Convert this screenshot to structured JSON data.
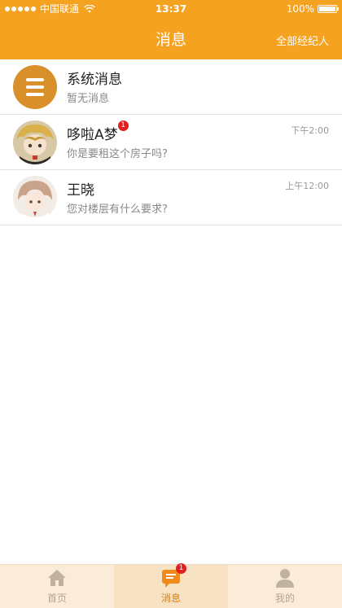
{
  "status_bar": {
    "carrier": "中国联通",
    "time": "13:37",
    "battery": "100%"
  },
  "header": {
    "title": "消息",
    "action": "全部经纪人"
  },
  "messages": [
    {
      "name": "系统消息",
      "preview": "暂无消息",
      "time": "",
      "badge": ""
    },
    {
      "name": "哆啦A梦",
      "preview": "你是要租这个房子吗?",
      "time": "下午2:00",
      "badge": "1"
    },
    {
      "name": "王晓",
      "preview": "您对楼层有什么要求?",
      "time": "上午12:00",
      "badge": ""
    }
  ],
  "tabs": [
    {
      "label": "首页",
      "icon": "home-icon"
    },
    {
      "label": "消息",
      "icon": "message-icon",
      "badge": "1"
    },
    {
      "label": "我的",
      "icon": "profile-icon"
    }
  ],
  "colors": {
    "brand": "#f4a21f",
    "system_avatar": "#d9902a",
    "tabbar_bg": "#faecd9",
    "tab_active": "#d67f16",
    "badge": "#e02020"
  }
}
